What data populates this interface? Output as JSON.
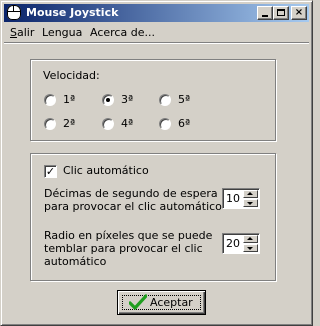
{
  "window": {
    "title": "Mouse Joystick",
    "controls": {
      "minimize_icon": "minimize-icon",
      "maximize_icon": "maximize-icon",
      "close_icon": "close-icon",
      "close_glyph": "×"
    },
    "title_gradient": [
      "#0a246a",
      "#a6caf0"
    ]
  },
  "menu": {
    "items": [
      {
        "label": "Salir",
        "underline": "S",
        "rest": "alir"
      },
      {
        "label": "Lengua"
      },
      {
        "label": "Acerca de..."
      }
    ]
  },
  "speed": {
    "label": "Velocidad:",
    "options": [
      "1ª",
      "2ª",
      "3ª",
      "4ª",
      "5ª",
      "6ª"
    ],
    "selected": "3ª"
  },
  "click": {
    "auto_label": "Clic automático",
    "auto_checked": true,
    "check_glyph": "✓",
    "delay_label_line1": "Décimas de segundo de espera",
    "delay_label_line2": "para provocar el clic automático",
    "delay_value": "10",
    "radius_label_line1": "Radio en píxeles que se puede",
    "radius_label_line2": "temblar para provocar el clic",
    "radius_label_line3": "automático",
    "radius_value": "20"
  },
  "accept_button": {
    "label": "Aceptar",
    "icon": "green-check-icon",
    "icon_color": "#1f9e1f"
  }
}
